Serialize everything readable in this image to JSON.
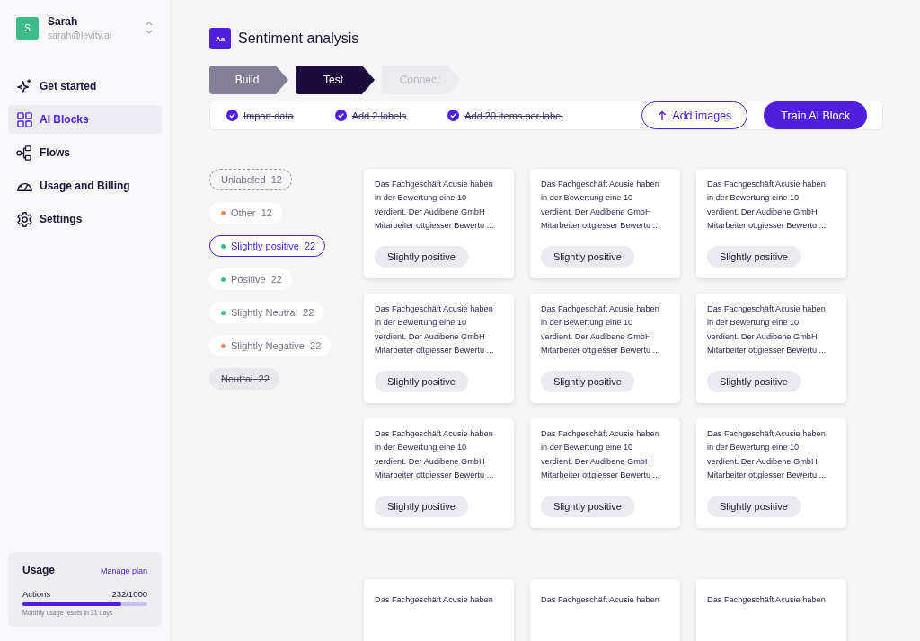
{
  "user": {
    "initial": "S",
    "name": "Sarah",
    "email": "sarah@levity.ai"
  },
  "nav": [
    {
      "label": "Get started",
      "kind": "sparkle",
      "selected": false
    },
    {
      "label": "AI Blocks",
      "kind": "grid",
      "selected": true
    },
    {
      "label": "Flows",
      "kind": "flow",
      "selected": false
    },
    {
      "label": "Usage and Billing",
      "kind": "gauge",
      "selected": false
    },
    {
      "label": "Settings",
      "kind": "gear",
      "selected": false
    }
  ],
  "usage": {
    "title": "Usage",
    "link": "Manage plan",
    "metric": "Actions",
    "reading": "232/1000",
    "level": 0.79,
    "note": "Monthly usage resets in 31 days"
  },
  "header": {
    "badge": "Aa",
    "title": "Sentiment analysis"
  },
  "steps": [
    {
      "label": "Build",
      "kind": "done"
    },
    {
      "label": "Test",
      "kind": "current"
    },
    {
      "label": "Connect",
      "kind": "disabled"
    }
  ],
  "checklist": [
    {
      "label": "Import data",
      "checked": true
    },
    {
      "label": "Add 2 labels",
      "checked": true
    },
    {
      "label": "Add 20 items per label",
      "checked": true
    }
  ],
  "buttons": {
    "secondary": "Add images",
    "primary": "Train AI Block"
  },
  "labels": [
    {
      "name": "Unlabeled",
      "count": "12",
      "kind": "unlabeled",
      "selected": false,
      "disabled": false
    },
    {
      "name": "Other",
      "count": "12",
      "kind": "label",
      "color": "#f08a5d",
      "selected": false,
      "disabled": false
    },
    {
      "name": "Slightly positive",
      "count": "22",
      "kind": "label",
      "color": "#3dbb8a",
      "selected": true,
      "disabled": false
    },
    {
      "name": "Positive",
      "count": "22",
      "kind": "label",
      "color": "#3dbb8a",
      "selected": false,
      "disabled": false
    },
    {
      "name": "Slightly Neutral",
      "count": "22",
      "kind": "label",
      "color": "#3dbb8a",
      "selected": false,
      "disabled": false
    },
    {
      "name": "Slightly Negative",
      "count": "22",
      "kind": "label",
      "color": "#f08a5d",
      "selected": false,
      "disabled": false
    },
    {
      "name": "Neutral",
      "count": "22",
      "kind": "plain",
      "selected": false,
      "disabled": true
    }
  ],
  "cards": [
    {
      "lines": [
        "Das Fachgeschäft Acusie haben",
        "in der Bewertung eine 10",
        "verdient. Der Audibene GmbH",
        "Mitarbeiter ottgiesser Bewertu ..."
      ],
      "tag": "Slightly positive"
    },
    {
      "lines": [
        "Das Fachgeschäft Acusie haben",
        "in der Bewertung eine 10",
        "verdient. Der Audibene GmbH",
        "Mitarbeiter ottgiesser Bewertu ..."
      ],
      "tag": "Slightly positive"
    },
    {
      "lines": [
        "Das Fachgeschäft Acusie haben",
        "in der Bewertung eine 10",
        "verdient. Der Audibene GmbH",
        "Mitarbeiter ottgiesser Bewertu ..."
      ],
      "tag": "Slightly positive"
    },
    {
      "lines": [
        "Das Fachgeschäft Acusie haben",
        "in der Bewertung eine 10",
        "verdient. Der Audibene GmbH",
        "Mitarbeiter ottgiesser Bewertu ..."
      ],
      "tag": "Slightly positive"
    },
    {
      "lines": [
        "Das Fachgeschäft Acusie haben",
        "in der Bewertung eine 10",
        "verdient. Der Audibene GmbH",
        "Mitarbeiter ottgiesser Bewertu ..."
      ],
      "tag": "Slightly positive"
    },
    {
      "lines": [
        "Das Fachgeschäft Acusie haben",
        "in der Bewertung eine 10",
        "verdient. Der Audibene GmbH",
        "Mitarbeiter ottgiesser Bewertu ..."
      ],
      "tag": "Slightly positive"
    },
    {
      "lines": [
        "Das Fachgeschäft Acusie haben",
        "in der Bewertung eine 10",
        "verdient. Der Audibene GmbH",
        "Mitarbeiter ottgiesser Bewertu ..."
      ],
      "tag": "Slightly positive"
    },
    {
      "lines": [
        "Das Fachgeschäft Acusie haben",
        "in der Bewertung eine 10",
        "verdient. Der Audibene GmbH",
        "Mitarbeiter ottgiesser Bewertu ..."
      ],
      "tag": "Slightly positive"
    },
    {
      "lines": [
        "Das Fachgeschäft Acusie haben",
        "in der Bewertung eine 10",
        "verdient. Der Audibene GmbH",
        "Mitarbeiter ottgiesser Bewertu ..."
      ],
      "tag": "Slightly positive"
    }
  ],
  "more_cards": [
    {
      "lines": [
        "Das Fachgeschäft Acusie haben"
      ]
    },
    {
      "lines": [
        "Das Fachgeschäft Acusie haben"
      ]
    },
    {
      "lines": [
        "Das Fachgeschäft Acusie haben"
      ]
    }
  ]
}
